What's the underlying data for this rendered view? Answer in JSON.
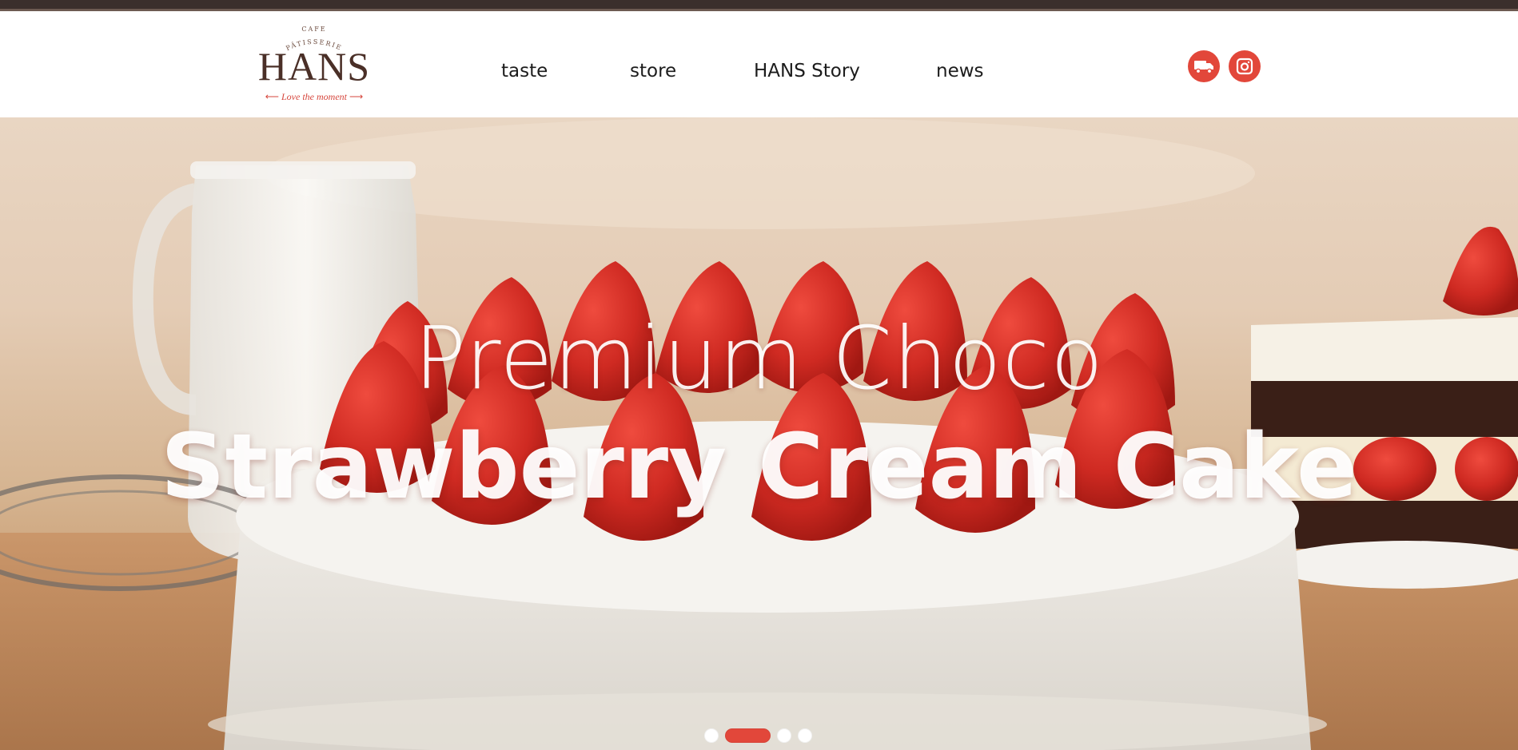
{
  "brand": {
    "top": "CAFE",
    "arc": "PÂTISSERIE",
    "name": "HANS",
    "tagline": "Love the moment",
    "arrow_left": "⟵",
    "arrow_right": "⟶"
  },
  "nav": {
    "items": [
      {
        "label": "taste"
      },
      {
        "label": "store"
      },
      {
        "label": "HANS Story"
      },
      {
        "label": "news"
      }
    ]
  },
  "social": {
    "delivery_icon": "delivery-truck-icon",
    "instagram_icon": "instagram-icon"
  },
  "hero": {
    "line1": "Premium Choco",
    "line2": "Strawberry Cream Cake"
  },
  "slider": {
    "slide_count": 4,
    "active_index": 1
  },
  "colors": {
    "accent": "#e2473a",
    "brand_brown": "#4a2f27",
    "top_strip": "#3b2f2c"
  }
}
